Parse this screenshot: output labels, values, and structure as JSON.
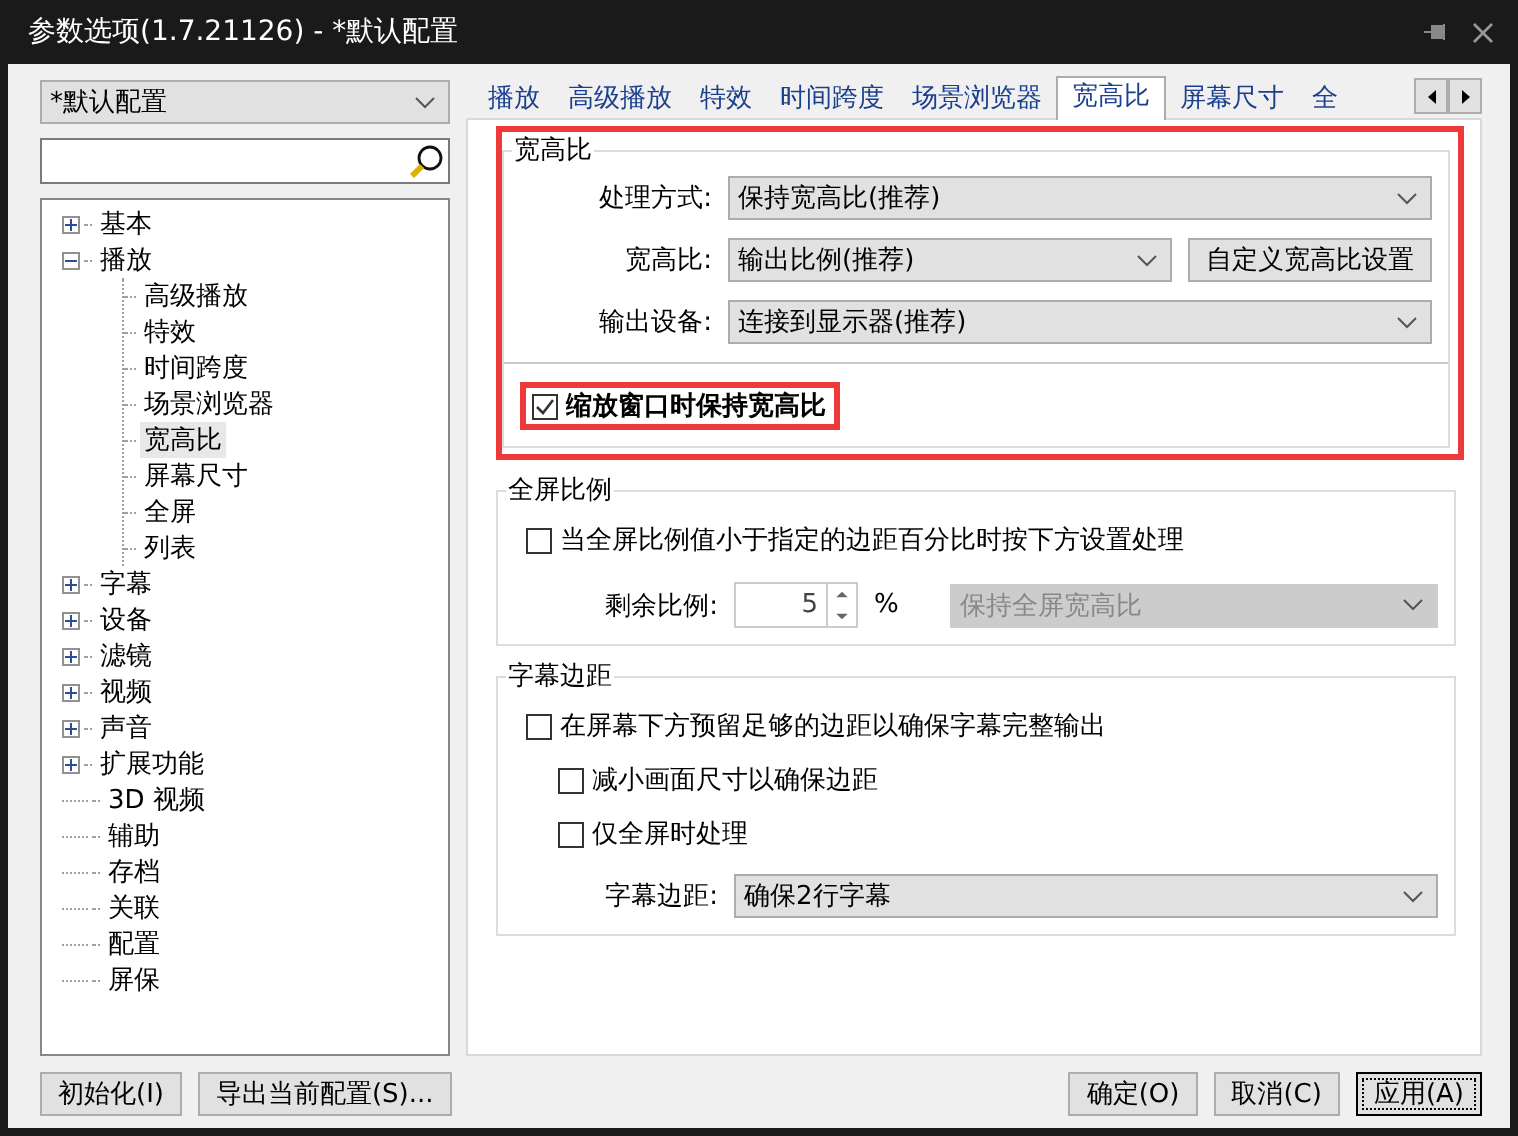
{
  "window": {
    "title": "参数选项(1.7.21126) - *默认配置"
  },
  "profile_select": {
    "value": "*默认配置"
  },
  "tree": [
    {
      "label": "基本",
      "kind": "group",
      "expanded": false,
      "selected": false
    },
    {
      "label": "播放",
      "kind": "group",
      "expanded": true,
      "selected": false,
      "children": [
        {
          "label": "高级播放",
          "selected": false
        },
        {
          "label": "特效",
          "selected": false
        },
        {
          "label": "时间跨度",
          "selected": false
        },
        {
          "label": "场景浏览器",
          "selected": false
        },
        {
          "label": "宽高比",
          "selected": true
        },
        {
          "label": "屏幕尺寸",
          "selected": false
        },
        {
          "label": "全屏",
          "selected": false
        },
        {
          "label": "列表",
          "selected": false
        }
      ]
    },
    {
      "label": "字幕",
      "kind": "group",
      "expanded": false,
      "selected": false
    },
    {
      "label": "设备",
      "kind": "group",
      "expanded": false,
      "selected": false
    },
    {
      "label": "滤镜",
      "kind": "group",
      "expanded": false,
      "selected": false
    },
    {
      "label": "视频",
      "kind": "group",
      "expanded": false,
      "selected": false
    },
    {
      "label": "声音",
      "kind": "group",
      "expanded": false,
      "selected": false
    },
    {
      "label": "扩展功能",
      "kind": "group",
      "expanded": false,
      "selected": false
    },
    {
      "label": "3D 视频",
      "kind": "leaf",
      "selected": false
    },
    {
      "label": "辅助",
      "kind": "leaf",
      "selected": false
    },
    {
      "label": "存档",
      "kind": "leaf",
      "selected": false
    },
    {
      "label": "关联",
      "kind": "leaf",
      "selected": false
    },
    {
      "label": "配置",
      "kind": "leaf",
      "selected": false
    },
    {
      "label": "屏保",
      "kind": "leaf",
      "selected": false
    }
  ],
  "tabs": [
    {
      "label": "播放",
      "selected": false
    },
    {
      "label": "高级播放",
      "selected": false
    },
    {
      "label": "特效",
      "selected": false
    },
    {
      "label": "时间跨度",
      "selected": false
    },
    {
      "label": "场景浏览器",
      "selected": false
    },
    {
      "label": "宽高比",
      "selected": true
    },
    {
      "label": "屏幕尺寸",
      "selected": false
    },
    {
      "label": "全",
      "selected": false
    }
  ],
  "aspect_group": {
    "title": "宽高比",
    "highlighted": true,
    "rows": [
      {
        "label": "处理方式:",
        "value": "保持宽高比(推荐)"
      },
      {
        "label": "宽高比:",
        "value": "输出比例(推荐)",
        "button": "自定义宽高比设置"
      },
      {
        "label": "输出设备:",
        "value": "连接到显示器(推荐)"
      }
    ],
    "checkbox": {
      "label": "缩放窗口时保持宽高比",
      "checked": true,
      "highlighted": true
    }
  },
  "fullscreen_group": {
    "title": "全屏比例",
    "checkbox": {
      "label": "当全屏比例值小于指定的边距百分比时按下方设置处理",
      "checked": false
    },
    "spin": {
      "label": "剩余比例:",
      "value": "5",
      "unit": "%"
    },
    "select": {
      "value": "保持全屏宽高比",
      "disabled": true
    }
  },
  "subtitle_group": {
    "title": "字幕边距",
    "checkbox": {
      "label": "在屏幕下方预留足够的边距以确保字幕完整输出",
      "checked": false,
      "children": [
        {
          "label": "减小画面尺寸以确保边距",
          "checked": false
        },
        {
          "label": "仅全屏时处理",
          "checked": false
        }
      ]
    },
    "select": {
      "label": "字幕边距:",
      "value": "确保2行字幕",
      "disabled": false
    }
  },
  "buttons_left": [
    {
      "label": "初始化(I)",
      "focused": false
    },
    {
      "label": "导出当前配置(S)...",
      "focused": false
    }
  ],
  "buttons_right": [
    {
      "label": "确定(O)",
      "focused": false
    },
    {
      "label": "取消(C)",
      "focused": false
    },
    {
      "label": "应用(A)",
      "focused": true
    }
  ]
}
